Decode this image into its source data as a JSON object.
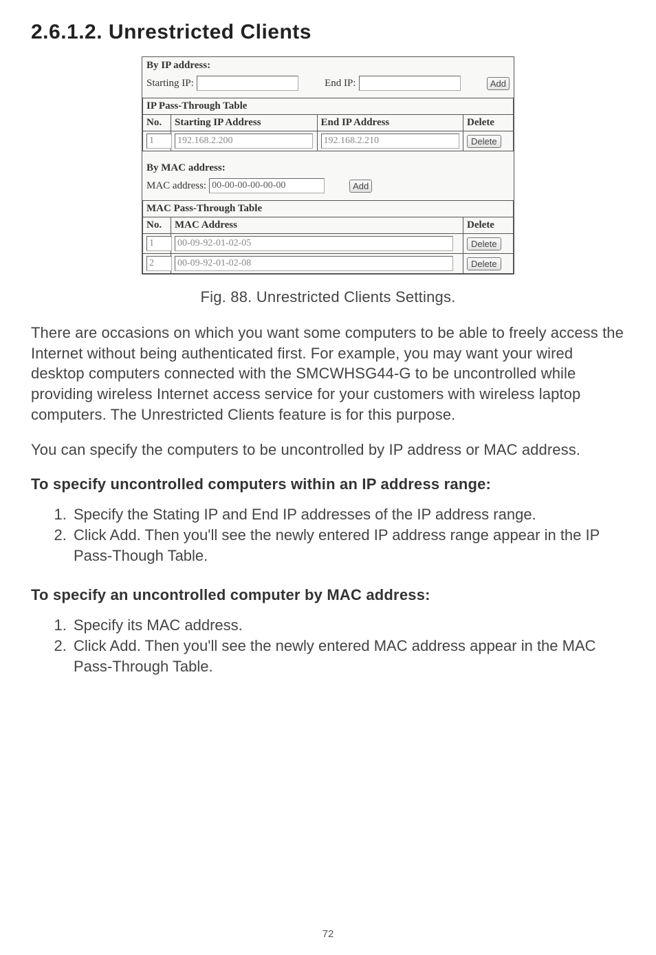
{
  "heading": "2.6.1.2. Unrestricted Clients",
  "panel": {
    "by_ip_label": "By IP address:",
    "starting_ip_label": "Starting IP:",
    "starting_ip_value": "",
    "end_ip_label": "End IP:",
    "end_ip_value": "",
    "add_ip_label": "Add",
    "ip_table_title": "IP Pass-Through Table",
    "ip_headers": [
      "No.",
      "Starting IP Address",
      "End IP Address",
      "Delete"
    ],
    "ip_rows": [
      {
        "no": "1",
        "start": "192.168.2.200",
        "end": "192.168.2.210",
        "delete_label": "Delete"
      }
    ],
    "by_mac_label": "By MAC address:",
    "mac_addr_label": "MAC address:",
    "mac_addr_value": "00-00-00-00-00-00",
    "add_mac_label": "Add",
    "mac_table_title": "MAC Pass-Through Table",
    "mac_headers": [
      "No.",
      "MAC Address",
      "Delete"
    ],
    "mac_rows": [
      {
        "no": "1",
        "mac": "00-09-92-01-02-05",
        "delete_label": "Delete"
      },
      {
        "no": "2",
        "mac": "00-09-92-01-02-08",
        "delete_label": "Delete"
      }
    ]
  },
  "figure_caption": "Fig. 88. Unrestricted Clients Settings.",
  "para1": "There are occasions on which you want some computers to be able to freely access the Internet without being authenticated first. For example, you may want your wired desktop computers connected with the SMCWHSG44-G to be uncontrolled while providing wireless Internet access service for your customers with wireless laptop computers. The Unrestricted Clients feature is for this purpose.",
  "para2": "You can specify the computers to be uncontrolled by IP address or MAC address.",
  "subhead1": "To specify uncontrolled computers within an IP address range:",
  "steps1": [
    "Specify the Stating IP and End IP addresses of the IP address range.",
    "Click Add. Then you'll see the newly entered IP address range appear in the IP Pass-Though Table."
  ],
  "subhead2": "To specify an uncontrolled computer by MAC address:",
  "steps2": [
    "Specify its MAC address.",
    "Click Add. Then you'll see the newly entered MAC address appear in the MAC Pass-Through Table."
  ],
  "page_number": "72"
}
